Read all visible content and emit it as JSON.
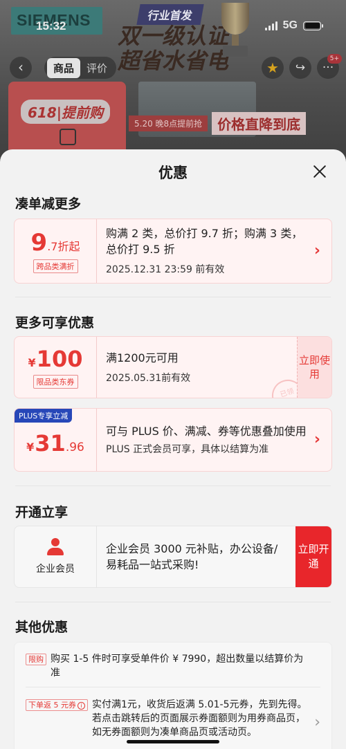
{
  "status_bar": {
    "time": "15:32",
    "network": "5G"
  },
  "backdrop": {
    "brand": "SIEMENS",
    "promo_tag": "行业首发",
    "promo_line1": "双一级认证",
    "promo_line2": "超省水省电",
    "tabs": [
      "商品",
      "评价"
    ],
    "thumb_label": "618|提前购",
    "price_drop_small": "5.20 晚8点提前抢",
    "price_drop_big": "价格直降到底",
    "badge": "5+"
  },
  "sheet": {
    "title": "优惠",
    "sections": {
      "bundle": "凑单减更多",
      "more": "更多可享优惠",
      "open": "开通立享",
      "other": "其他优惠"
    },
    "bundle_card": {
      "discount_int": "9",
      "discount_dec": ".7",
      "discount_unit": "折起",
      "tag": "跨品类满折",
      "line1": "购满 2 类，总价打 9.7 折；购满 3 类，总价打 9.5 折",
      "line2": "2025.12.31 23:59 前有效"
    },
    "coupon_card": {
      "yen": "¥",
      "amount": "100",
      "tag": "限品类东券",
      "line1": "满1200元可用",
      "line2": "2025.05.31前有效",
      "button": "立即使用",
      "stamp": "已领"
    },
    "plus_card": {
      "badge": "PLUS专享立减",
      "yen": "¥",
      "amount_int": "31",
      "amount_dec": ".96",
      "line1": "可与 PLUS 价、满减、券等优惠叠加使用",
      "line2": "PLUS 正式会员可享，具体以结算为准"
    },
    "member_card": {
      "label": "企业会员",
      "line1": "企业会员 3000 元补贴，办公设备/易耗品一站式采购!",
      "button": "立即开通"
    },
    "other_items": [
      {
        "tag": "限购",
        "text": "购买 1-5 件时可享受单件价 ¥ 7990，超出数量以结算价为准"
      },
      {
        "tag": "下单返 5 元券",
        "text": "实付满1元，收货后返满 5.01-5元券，先到先得。若点击跳转后的页面展示券面额则为用券商品页，如无券面额则为凑单商品页或活动页。"
      }
    ]
  },
  "colors": {
    "accent": "#e53935",
    "plus": "#2747b8",
    "pink_bg": "#fff3f3"
  }
}
